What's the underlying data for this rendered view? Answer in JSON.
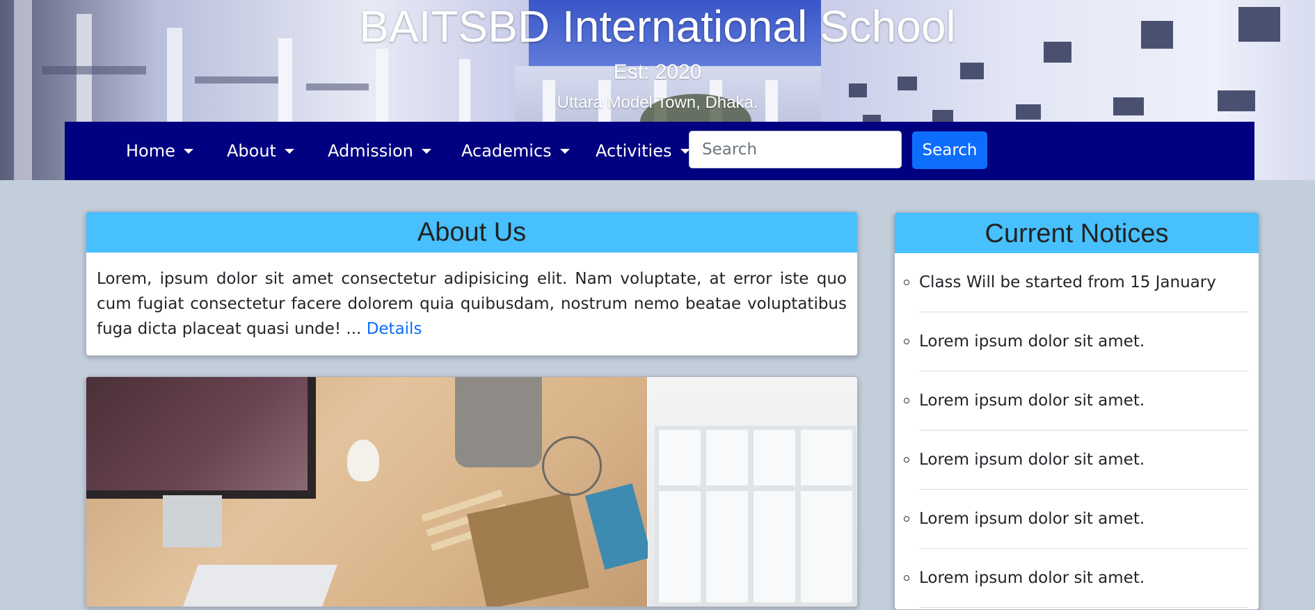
{
  "header": {
    "title": "BAITSBD International School",
    "established": "Est: 2020",
    "address": "Uttara Model Town, Dhaka."
  },
  "nav": {
    "items": [
      {
        "label": "Home"
      },
      {
        "label": "About"
      },
      {
        "label": "Admission"
      },
      {
        "label": "Academics"
      },
      {
        "label": "Activities"
      }
    ],
    "search_placeholder": "Search",
    "search_button": "Search"
  },
  "about": {
    "heading": "About Us",
    "body": "Lorem, ipsum dolor sit amet consectetur adipisicing elit. Nam voluptate, at error iste quo cum fugiat consectetur facere dolorem quia quibusdam, nostrum nemo beatae voluptatibus fuga dicta placeat quasi unde! ...",
    "link": "Details"
  },
  "notices": {
    "heading": "Current Notices",
    "items": [
      "Class Will be started from 15 January",
      "Lorem ipsum dolor sit amet.",
      "Lorem ipsum dolor sit amet.",
      "Lorem ipsum dolor sit amet.",
      "Lorem ipsum dolor sit amet.",
      "Lorem ipsum dolor sit amet."
    ]
  },
  "colors": {
    "page_bg": "#c3cedb",
    "navbar_bg": "#000080",
    "card_header": "#47c0fd",
    "primary": "#0d6efd"
  },
  "icons": [
    "dropdown-caret-icon",
    "notice-bullet-icon"
  ]
}
